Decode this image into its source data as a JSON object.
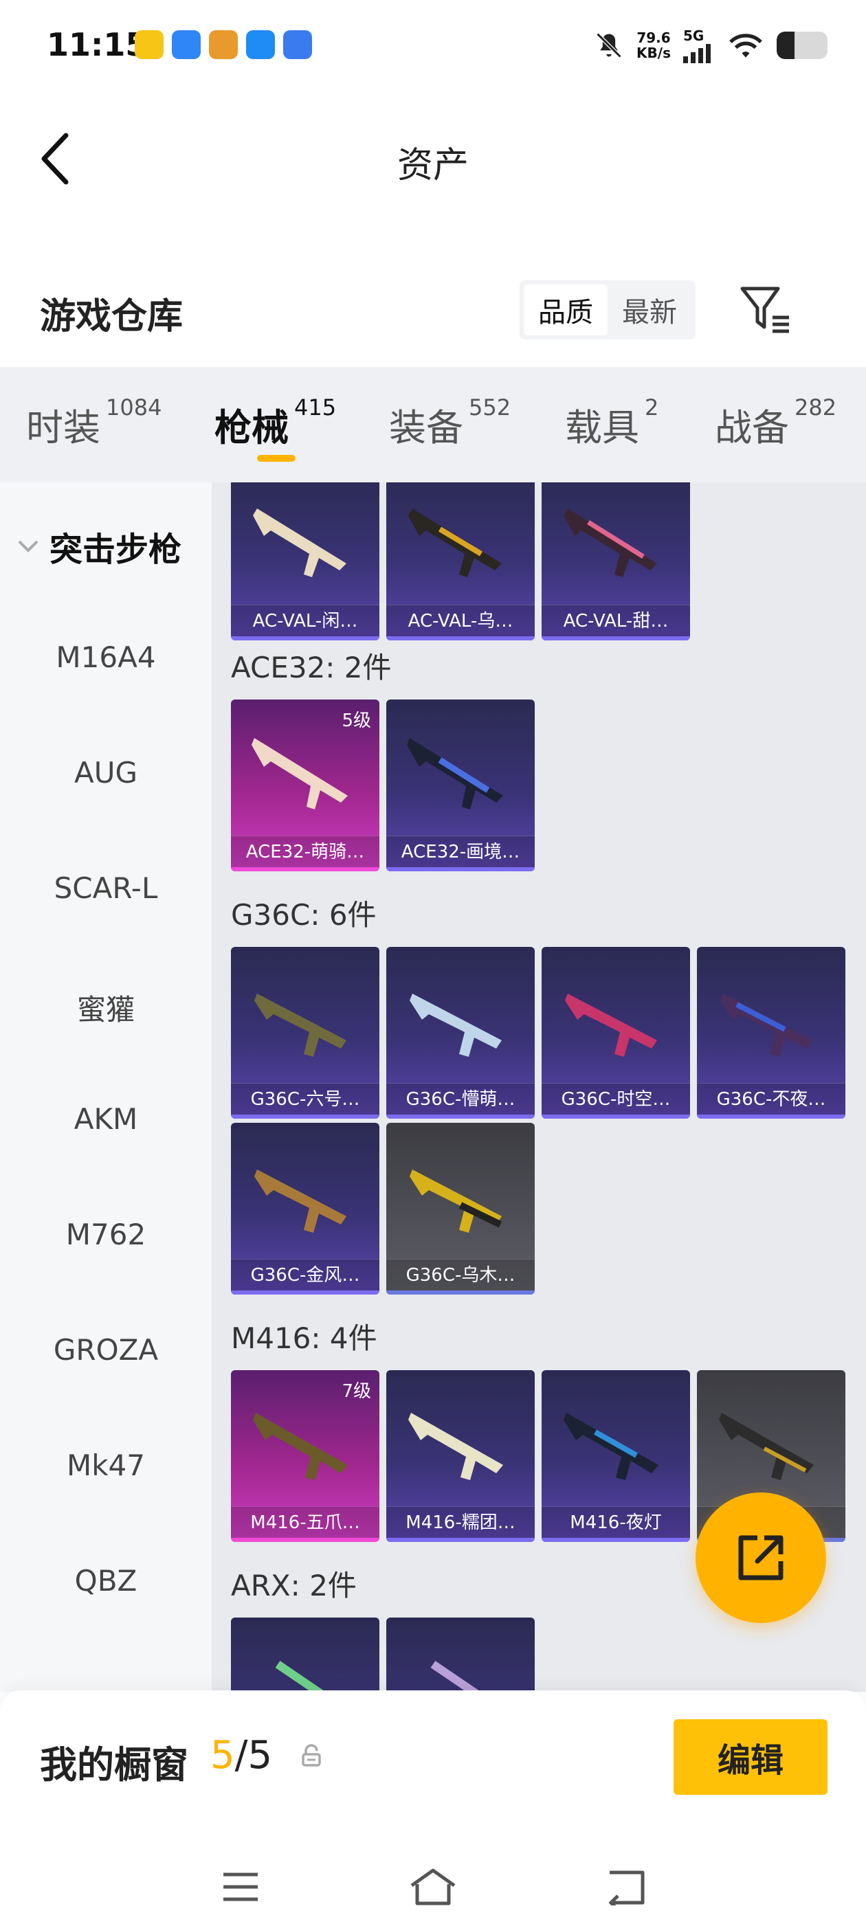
{
  "status_bar": {
    "time": "11:15",
    "net_speed_value": "79.6",
    "net_speed_unit": "KB/s",
    "net_type": "5G",
    "battery_level": 0.35
  },
  "header": {
    "title": "资产"
  },
  "warehouse": {
    "title": "游戏仓库",
    "sort_options": [
      "品质",
      "最新"
    ],
    "sort_selected": "品质"
  },
  "tabs": [
    {
      "label": "时装",
      "count": "1084"
    },
    {
      "label": "枪械",
      "count": "415",
      "active": true
    },
    {
      "label": "装备",
      "count": "552"
    },
    {
      "label": "载具",
      "count": "2"
    },
    {
      "label": "战备",
      "count": "282"
    }
  ],
  "sidebar": {
    "category": "突击步枪",
    "items": [
      "M16A4",
      "AUG",
      "SCAR-L",
      "蜜獾",
      "AKM",
      "M762",
      "GROZA",
      "Mk47",
      "QBZ"
    ]
  },
  "groups": [
    {
      "title": "",
      "items": [
        {
          "name": "AC-VAL-闲…",
          "tier": "purple"
        },
        {
          "name": "AC-VAL-乌…",
          "tier": "purple"
        },
        {
          "name": "AC-VAL-甜…",
          "tier": "purple"
        }
      ]
    },
    {
      "title": "ACE32: 2件",
      "items": [
        {
          "name": "ACE32-萌骑…",
          "tier": "gold",
          "level": "5级"
        },
        {
          "name": "ACE32-画境…",
          "tier": "purple"
        }
      ]
    },
    {
      "title": "G36C: 6件",
      "items": [
        {
          "name": "G36C-六号…",
          "tier": "purple"
        },
        {
          "name": "G36C-懵萌…",
          "tier": "purple"
        },
        {
          "name": "G36C-时空…",
          "tier": "purple"
        },
        {
          "name": "G36C-不夜…",
          "tier": "purple"
        },
        {
          "name": "G36C-金风…",
          "tier": "purple"
        },
        {
          "name": "G36C-乌木…",
          "tier": "grey"
        }
      ]
    },
    {
      "title": "M416: 4件",
      "items": [
        {
          "name": "M416-五爪…",
          "tier": "gold",
          "level": "7级"
        },
        {
          "name": "M416-糯团…",
          "tier": "purple"
        },
        {
          "name": "M416-夜灯",
          "tier": "purple"
        },
        {
          "name": "…",
          "tier": "grey"
        }
      ]
    },
    {
      "title": "ARX: 2件",
      "items": [
        {
          "name": "",
          "tier": "purple"
        },
        {
          "name": "",
          "tier": "purple"
        }
      ]
    }
  ],
  "showcase": {
    "title": "我的橱窗",
    "current": "5",
    "total": "/5",
    "edit_label": "编辑"
  },
  "colors": {
    "accent": "#ffb300",
    "edit_button": "#ffc107"
  },
  "icons": [
    "back-icon",
    "filter-icon",
    "chevron-down-icon",
    "share-icon",
    "lock-icon",
    "menu-icon",
    "home-icon",
    "return-icon"
  ]
}
